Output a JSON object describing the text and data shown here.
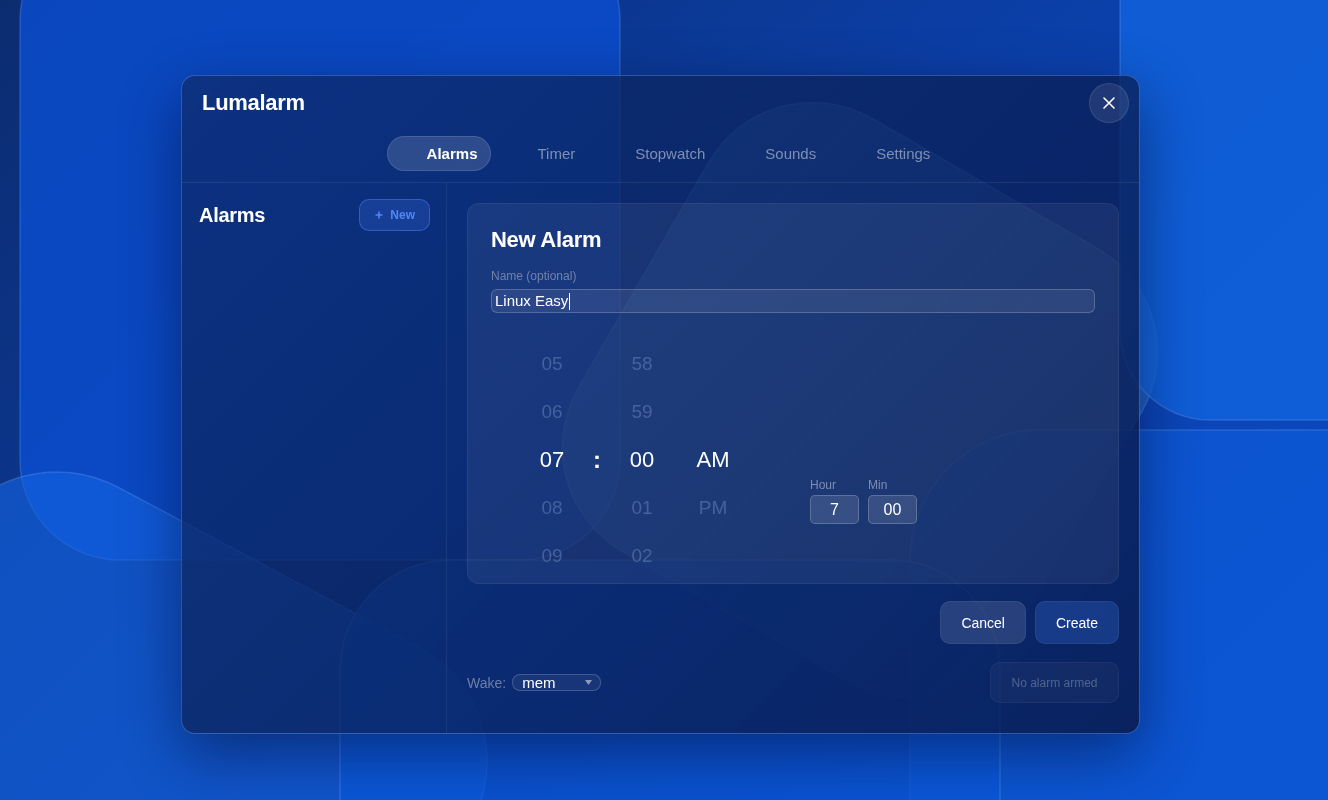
{
  "window": {
    "title": "Lumalarm"
  },
  "tabs": [
    {
      "label": "Alarms",
      "selected": true
    },
    {
      "label": "Timer",
      "selected": false
    },
    {
      "label": "Stopwatch",
      "selected": false
    },
    {
      "label": "Sounds",
      "selected": false
    },
    {
      "label": "Settings",
      "selected": false
    }
  ],
  "sidebar": {
    "title": "Alarms",
    "new_button": {
      "label": "New"
    }
  },
  "editor": {
    "title": "New Alarm",
    "name_field": {
      "label": "Name (optional)",
      "value": "Linux Easy",
      "focused": true
    },
    "picker": {
      "hours": [
        {
          "value": "05",
          "selected": false
        },
        {
          "value": "06",
          "selected": false
        },
        {
          "value": "07",
          "selected": true
        },
        {
          "value": "08",
          "selected": false
        },
        {
          "value": "09",
          "selected": false
        }
      ],
      "separator": ":",
      "minutes": [
        {
          "value": "58",
          "selected": false
        },
        {
          "value": "59",
          "selected": false
        },
        {
          "value": "00",
          "selected": true
        },
        {
          "value": "01",
          "selected": false
        },
        {
          "value": "02",
          "selected": false
        }
      ],
      "periods": [
        {
          "value": "AM",
          "selected": true
        },
        {
          "value": "PM",
          "selected": false
        }
      ]
    },
    "manual_fields": [
      {
        "label": "Hour",
        "value": "7"
      },
      {
        "label": "Min",
        "value": "00"
      }
    ]
  },
  "actions": [
    {
      "label": "Cancel",
      "kind": "secondary"
    },
    {
      "label": "Create",
      "kind": "primary"
    }
  ],
  "footer": {
    "wake": {
      "label": "Wake:",
      "value": "mem"
    },
    "status": {
      "label": "No alarm armed",
      "disabled": true
    }
  }
}
